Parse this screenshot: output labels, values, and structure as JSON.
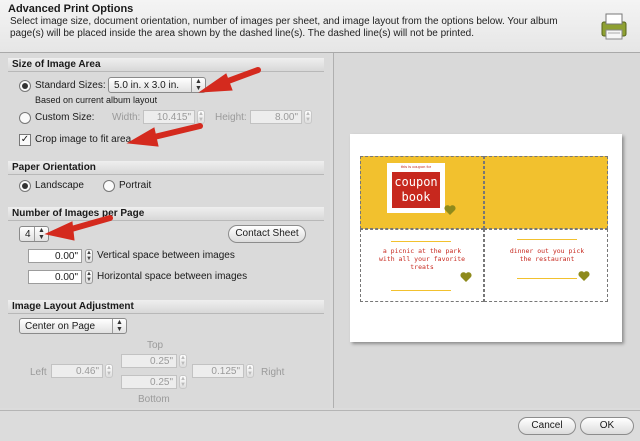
{
  "header": {
    "title": "Advanced Print Options",
    "description": "Select image size, document orientation, number of images per sheet, and image layout from the options below. Your album page(s) will be placed inside the area shown by the dashed line(s). The dashed line(s) will not be printed."
  },
  "size_area": {
    "heading": "Size of Image Area",
    "standard_label": "Standard Sizes:",
    "standard_value": "5.0 in. x 3.0 in.",
    "based_on": "Based on current album layout",
    "custom_label": "Custom Size:",
    "width_label": "Width:",
    "width_value": "10.415\"",
    "height_label": "Height:",
    "height_value": "8.00\"",
    "crop_label": "Crop image to fit area"
  },
  "orientation": {
    "heading": "Paper Orientation",
    "landscape": "Landscape",
    "portrait": "Portrait"
  },
  "images_per_page": {
    "heading": "Number of Images per Page",
    "count": "4",
    "contact_sheet": "Contact Sheet",
    "vertical_value": "0.00\"",
    "vertical_label": "Vertical space between images",
    "horizontal_value": "0.00\"",
    "horizontal_label": "Horizontal space between images"
  },
  "layout": {
    "heading": "Image Layout Adjustment",
    "position": "Center on Page",
    "top_label": "Top",
    "bottom_label": "Bottom",
    "left_label": "Left",
    "right_label": "Right",
    "top_value": "0.25\"",
    "bottom_value": "0.25\"",
    "left_value": "0.46\"",
    "right_value": "0.125\""
  },
  "preview": {
    "coupon_small": "this is coupon for",
    "coupon_word1": "coupon",
    "coupon_word2": "book",
    "card3_text": "a picnic at the park with all your favorite treats",
    "card4_text": "dinner out you pick the restaurant"
  },
  "footer": {
    "cancel": "Cancel",
    "ok": "OK"
  },
  "colors": {
    "arrow": "#d42a1e",
    "yellow": "#f2c12e",
    "coupon_red": "#c7281e"
  }
}
